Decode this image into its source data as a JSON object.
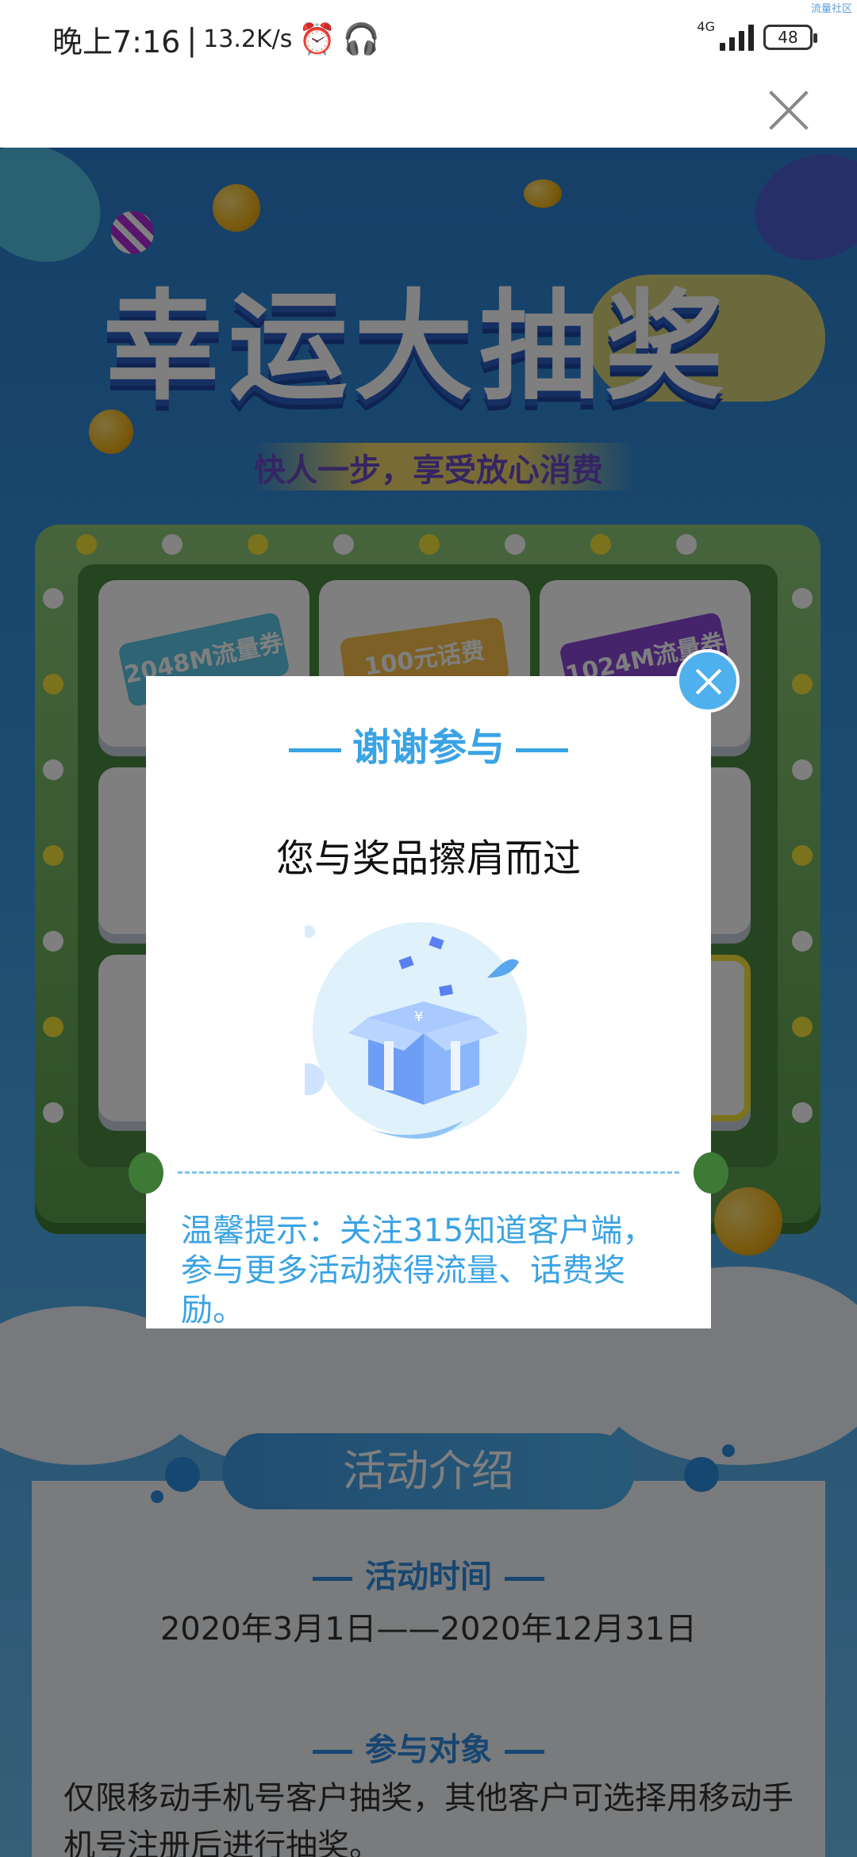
{
  "status_bar": {
    "time": "晚上7:16",
    "speed": "13.2K/s",
    "network": "4G",
    "battery": "48",
    "watermark": "流量社区"
  },
  "nav": {
    "close_icon": "close-icon"
  },
  "page": {
    "title": "幸运大抽奖",
    "subtitle": "快人一步，享受放心消费",
    "prizes": [
      {
        "label": "2048M流量券"
      },
      {
        "label": "100元话费"
      },
      {
        "label": "1024M流量券"
      }
    ],
    "intro": {
      "title": "活动介绍",
      "time_heading": "活动时间",
      "time_value": "2020年3月1日——2020年12月31日",
      "audience_heading": "参与对象",
      "audience_value": "仅限移动手机号客户抽奖，其他客户可选择用移动手机号注册后进行抽奖。"
    }
  },
  "modal": {
    "title": "谢谢参与",
    "message": "您与奖品擦肩而过",
    "tip": "温馨提示：关注315知道客户端，参与更多活动获得流量、话费奖励。",
    "close_icon": "close-icon",
    "illustration_icon": "gift-box-icon"
  },
  "colors": {
    "accent": "#3aa3e4",
    "board": "#5a9e4a",
    "page_bg": "#2f8fd6"
  }
}
